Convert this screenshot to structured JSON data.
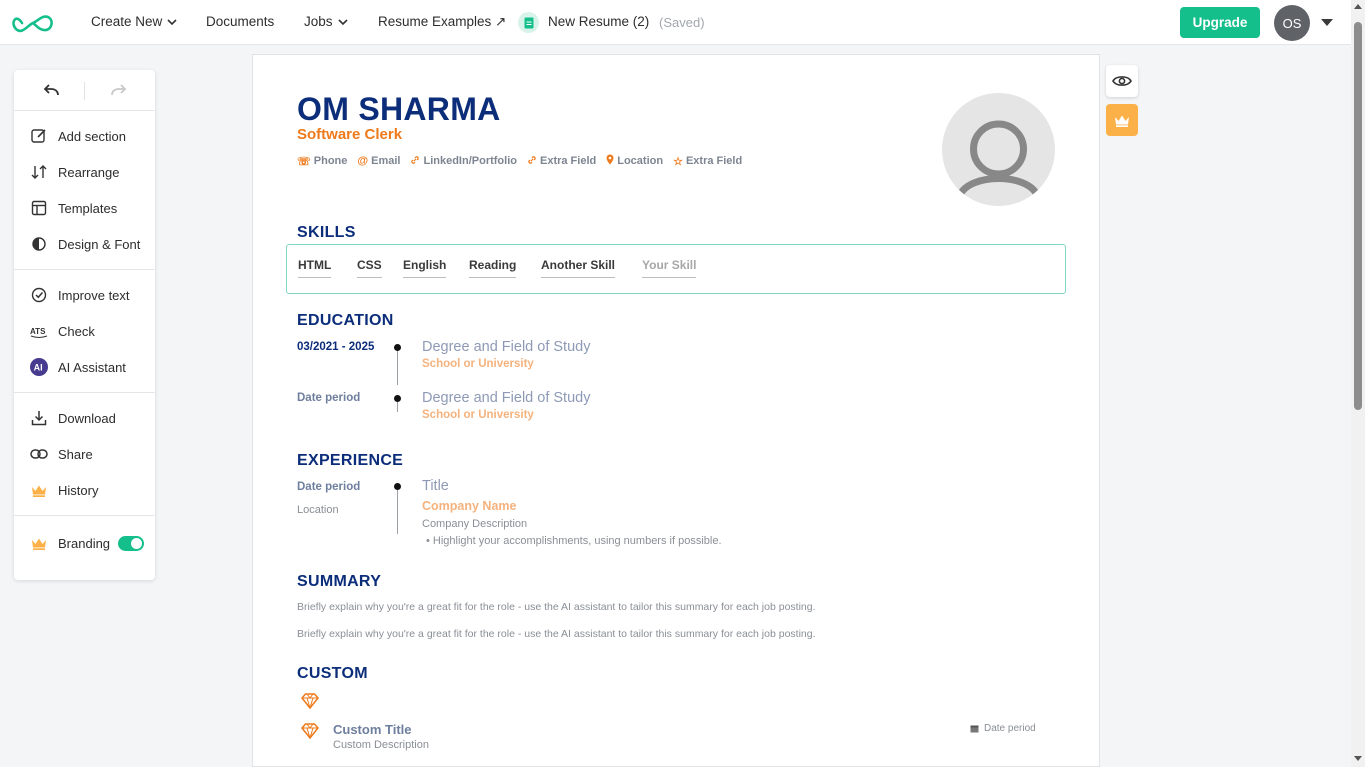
{
  "topbar": {
    "create_new": "Create New",
    "documents": "Documents",
    "jobs": "Jobs",
    "resume_examples": "Resume Examples ↗",
    "doc_name": "New Resume (2)",
    "saved": "(Saved)",
    "upgrade": "Upgrade",
    "avatar_initials": "OS"
  },
  "sidebar": {
    "group1": [
      {
        "label": "Add section",
        "icon": "edit-icon"
      },
      {
        "label": "Rearrange",
        "icon": "rearrange-icon"
      },
      {
        "label": "Templates",
        "icon": "templates-icon"
      },
      {
        "label": "Design & Font",
        "icon": "contrast-icon"
      }
    ],
    "group2": [
      {
        "label": "Improve text",
        "icon": "check-circle-icon"
      },
      {
        "label": "Check",
        "icon": "ats-icon"
      },
      {
        "label": "AI Assistant",
        "icon": "ai-icon"
      }
    ],
    "group3": [
      {
        "label": "Download",
        "icon": "download-icon"
      },
      {
        "label": "Share",
        "icon": "link-icon"
      },
      {
        "label": "History",
        "icon": "crown-icon"
      }
    ],
    "branding": {
      "label": "Branding",
      "enabled": true
    }
  },
  "resume": {
    "name": "OM SHARMA",
    "title": "Software Clerk",
    "contacts": [
      {
        "label": "Phone",
        "icon": "☏"
      },
      {
        "label": "Email",
        "icon": "@"
      },
      {
        "label": "LinkedIn/Portfolio",
        "icon": "🔗"
      },
      {
        "label": "Extra Field",
        "icon": "🔗"
      },
      {
        "label": "Location",
        "icon": "📍"
      },
      {
        "label": "Extra Field",
        "icon": "☆"
      }
    ],
    "skills_title": "SKILLS",
    "skills": [
      "HTML",
      "CSS",
      "English",
      "Reading",
      "Another Skill",
      "Your Skill"
    ],
    "education_title": "EDUCATION",
    "education": [
      {
        "date": "03/2021 - 2025",
        "degree": "Degree and Field of Study",
        "school": "School or University"
      },
      {
        "date": "Date period",
        "degree": "Degree and Field of Study",
        "school": "School or University"
      }
    ],
    "experience_title": "EXPERIENCE",
    "experience": {
      "date": "Date period",
      "location": "Location",
      "title": "Title",
      "company": "Company Name",
      "description": "Company Description",
      "bullet": "Highlight your accomplishments, using numbers if possible."
    },
    "summary_title": "SUMMARY",
    "summary_lines": [
      "Briefly explain why you're a great fit for the role - use the AI assistant to tailor this summary for each job posting.",
      "Briefly explain why you're a great fit for the role - use the AI assistant to tailor this summary for each job posting."
    ],
    "custom_title": "CUSTOM",
    "custom": {
      "title": "Custom Title",
      "description": "Custom Description",
      "date": "Date period"
    }
  },
  "colors": {
    "brand_green": "#14bf8b",
    "navy": "#0b2d7a",
    "orange": "#ee7a1b"
  }
}
